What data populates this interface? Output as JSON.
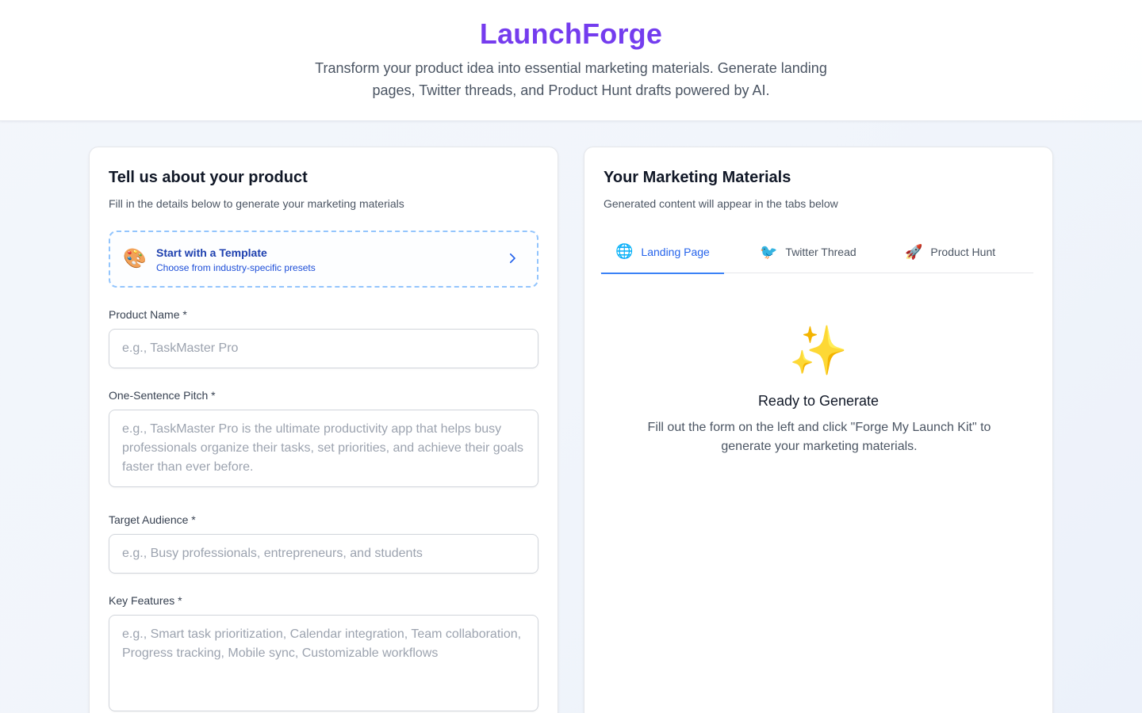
{
  "header": {
    "brand": "LaunchForge",
    "tagline": "Transform your product idea into essential marketing materials. Generate landing pages, Twitter threads, and Product Hunt drafts powered by AI."
  },
  "form": {
    "title": "Tell us about your product",
    "subtitle": "Fill in the details below to generate your marketing materials",
    "template": {
      "icon": "palette-icon",
      "title": "Start with a Template",
      "subtitle": "Choose from industry-specific presets"
    },
    "product_name": {
      "label": "Product Name *",
      "value": "",
      "placeholder": "e.g., TaskMaster Pro"
    },
    "pitch": {
      "label": "One-Sentence Pitch *",
      "value": "",
      "placeholder": "e.g., TaskMaster Pro is the ultimate productivity app that helps busy professionals organize their tasks, set priorities, and achieve their goals faster than ever before."
    },
    "audience": {
      "label": "Target Audience *",
      "value": "",
      "placeholder": "e.g., Busy professionals, entrepreneurs, and students"
    },
    "features": {
      "label": "Key Features *",
      "value": "",
      "placeholder": "e.g., Smart task prioritization, Calendar integration, Team collaboration, Progress tracking, Mobile sync, Customizable workflows"
    }
  },
  "output": {
    "title": "Your Marketing Materials",
    "subtitle": "Generated content will appear in the tabs below",
    "tabs": [
      {
        "icon": "globe-icon",
        "label": "Landing Page",
        "active": true
      },
      {
        "icon": "bird-icon",
        "label": "Twitter Thread",
        "active": false
      },
      {
        "icon": "rocket-icon",
        "label": "Product Hunt",
        "active": false
      }
    ],
    "empty": {
      "icon": "sparkles-icon",
      "title": "Ready to Generate",
      "text": "Fill out the form on the left and click \"Forge My Launch Kit\" to generate your marketing materials."
    }
  },
  "colors": {
    "brand": "#7c3aed",
    "accent": "#2563eb",
    "template_border": "#93c5fd"
  }
}
